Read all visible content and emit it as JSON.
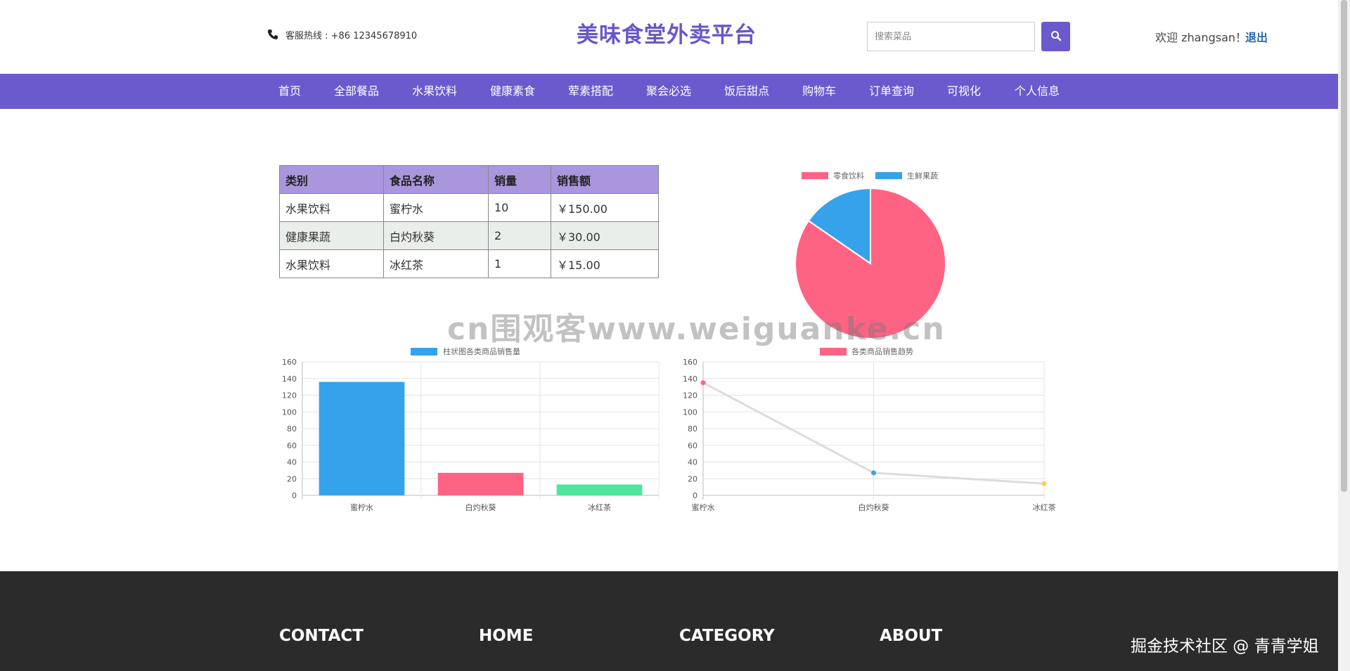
{
  "header": {
    "hotline": "客服热线 : +86 12345678910",
    "site_title": "美味食堂外卖平台",
    "search_placeholder": "搜索菜品",
    "welcome": "欢迎 zhangsan！",
    "logout": "退出"
  },
  "nav": {
    "items": [
      "首页",
      "全部餐品",
      "水果饮料",
      "健康素食",
      "荤素搭配",
      "聚会必选",
      "饭后甜点",
      "购物车",
      "订单查询",
      "可视化",
      "个人信息"
    ]
  },
  "table": {
    "headers": [
      "类别",
      "食品名称",
      "销量",
      "销售额"
    ],
    "rows": [
      [
        "水果饮料",
        "蜜柠水",
        "10",
        "￥150.00"
      ],
      [
        "健康果蔬",
        "白灼秋葵",
        "2",
        "￥30.00"
      ],
      [
        "水果饮料",
        "冰红茶",
        "1",
        "￥15.00"
      ]
    ]
  },
  "chart_data": [
    {
      "type": "pie",
      "legend": [
        "零食饮料",
        "生鲜果蔬"
      ],
      "values": [
        165,
        30
      ],
      "colors": [
        "#ff6384",
        "#36a2eb"
      ]
    },
    {
      "type": "bar",
      "legend": "柱状图各类商品销售量",
      "categories": [
        "蜜柠水",
        "白灼秋葵",
        "冰红茶"
      ],
      "values": [
        136,
        27,
        13
      ],
      "colors": [
        "#36a2eb",
        "#ff6384",
        "#4ee59d"
      ],
      "ylim": [
        0,
        160
      ],
      "yticks": [
        "0",
        "20",
        "40",
        "60",
        "80",
        "100",
        "120",
        "140",
        "160"
      ]
    },
    {
      "type": "line",
      "legend": "各类商品销售趋势",
      "categories": [
        "蜜柠水",
        "白灼秋葵",
        "冰红茶"
      ],
      "values": [
        135,
        27,
        14
      ],
      "point_colors": [
        "#ff6384",
        "#36a2eb",
        "#ffce56"
      ],
      "legend_color": "#ff6384",
      "ylim": [
        0,
        160
      ],
      "yticks": [
        "0",
        "20",
        "40",
        "60",
        "80",
        "100",
        "120",
        "140",
        "160"
      ]
    }
  ],
  "watermark": "cn围观客www.weiguanke.cn",
  "footer": {
    "headings": [
      "CONTACT",
      "HOME",
      "CATEGORY",
      "ABOUT"
    ],
    "credit": "掘金技术社区 @ 青青学姐"
  },
  "colors": {
    "accent": "#6a5acd",
    "title": "#6a56c9",
    "table_header": "#a996dd",
    "footer_bg": "#2b2b2b"
  }
}
